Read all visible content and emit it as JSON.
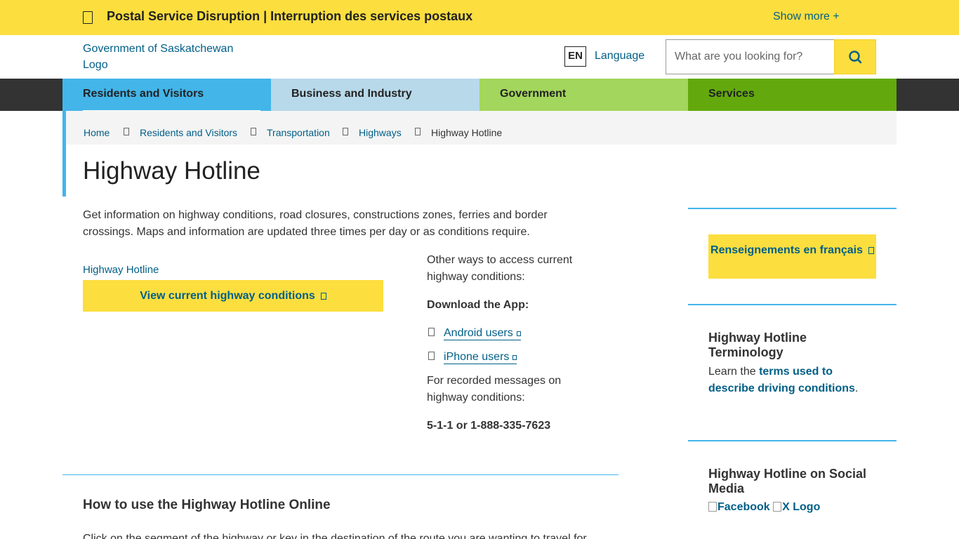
{
  "alert": {
    "title": "Postal Service Disruption | Interruption des services postaux",
    "show_more": "Show more  +"
  },
  "header": {
    "logo_alt": "Government of Saskatchewan Logo",
    "lang_code": "EN",
    "language_label": "Language",
    "search_placeholder": "What are you looking for?"
  },
  "nav": {
    "tabs": [
      {
        "label": "Residents and Visitors",
        "color": "#43b5e9"
      },
      {
        "label": "Business and Industry",
        "color": "#b8d9ea"
      },
      {
        "label": "Government",
        "color": "#a3d65c"
      },
      {
        "label": "Services",
        "color": "#63a90d"
      }
    ]
  },
  "breadcrumb": [
    "Home",
    "Residents and Visitors",
    "Transportation",
    "Highways",
    "Highway Hotline"
  ],
  "page": {
    "title": "Highway Hotline",
    "intro": "Get information on highway conditions, road closures, constructions zones, ferries and border crossings. Maps and information are updated three times per day or as conditions require.",
    "image_alt": "Highway Hotline",
    "conditions_button": "View current highway conditions",
    "other_ways": "Other ways to access current highway conditions:",
    "download_heading": "Download the App:",
    "apps": [
      "Android users",
      "iPhone users"
    ],
    "recorded": "For recorded messages on highway conditions:",
    "phone": "5-1-1 or 1-888-335-7623",
    "section_heading": "How to use the Highway Hotline Online",
    "section_body": "Click on the segment of the highway or key in the destination of the route you are wanting to travel for"
  },
  "sidebar": {
    "french_button": "Renseignements en français",
    "terminology_heading": "Highway Hotline Terminology",
    "terminology_prefix": "Learn the ",
    "terminology_link": "terms used to describe driving conditions",
    "terminology_suffix": ".",
    "social_heading": "Highway Hotline on Social Media",
    "social": [
      "Facebook",
      "X Logo"
    ]
  },
  "colors": {
    "yellow": "#fcde3f",
    "link": "#005f87",
    "accent_blue": "#43b5e9",
    "nav_dark": "#333333"
  }
}
